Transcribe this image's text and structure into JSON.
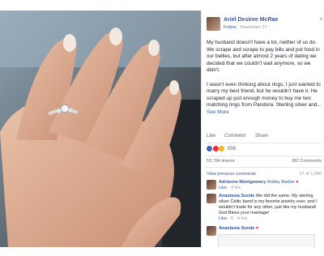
{
  "post": {
    "author": "Ariel Desiree McRae",
    "follow": "Follow",
    "separator": " · ",
    "date": "November 27 · ",
    "paragraph1": "My husband doesn't have a lot, neither of us do. We scrape and scrape to pay bills and put food in our bellies, but after almost 2 years of dating we decided that we couldn't wait anymore, so we didn't.",
    "paragraph2": "I wasn't even thinking about rings, I just wanted to marry my best friend, but he wouldn't have it. He scraped up just enough money to buy me two matching rings from Pandora. Sterling silver and...",
    "see_more": "See More"
  },
  "actions": {
    "like": "Like",
    "comment": "Comment",
    "share": "Share"
  },
  "reactions": {
    "count": "65K"
  },
  "stats": {
    "shares": "53,784 shares",
    "comments": "382 Comments"
  },
  "comments_nav": {
    "view_previous": "View previous comments",
    "count": "17 of 1,006"
  },
  "comments": [
    {
      "name": "Adrienne Montgomery",
      "tag": "Robby Barber",
      "heart": "♥",
      "meta_like": "Like",
      "meta_time": " · 4 hrs"
    },
    {
      "name": "Anastasia Sunde",
      "text": " We did the same. My sterling silver Celtic band is my favorite jewelry ever, and I wouldn't trade for any other, just like my husband! God Bless your marriage!",
      "meta_like": "Like",
      "meta_time": " · 6 · 4 hrs"
    },
    {
      "name": "Anastasia Sunde",
      "heart": "♥"
    }
  ],
  "colors": {
    "link": "#365899",
    "background": "#ffffff",
    "text": "#1d2129",
    "muted": "#90949c"
  },
  "icons": [
    "close-icon",
    "like-reaction-icon",
    "love-reaction-icon",
    "wow-reaction-icon",
    "heart-icon"
  ]
}
